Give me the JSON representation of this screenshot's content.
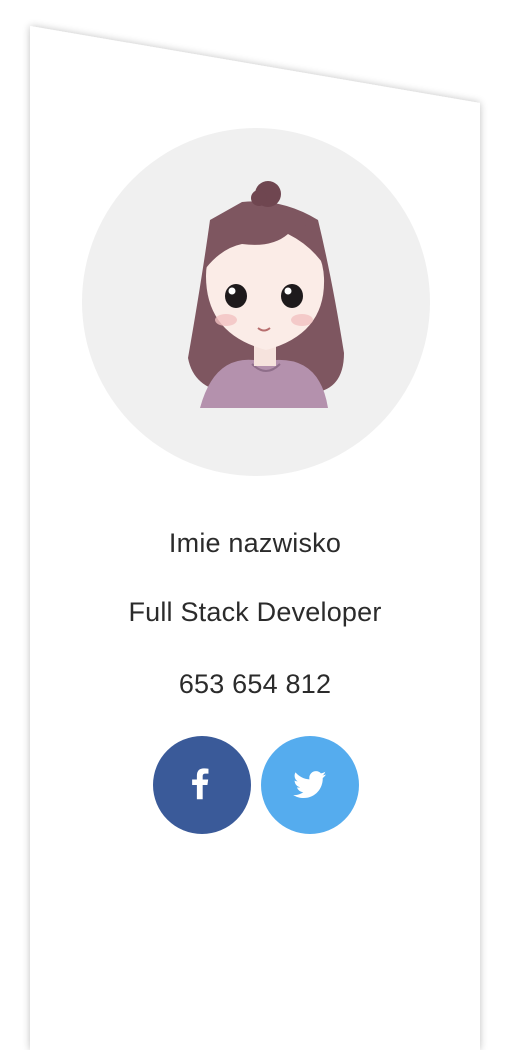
{
  "profile": {
    "name": "Imie nazwisko",
    "title": "Full Stack Developer",
    "phone": "653 654 812",
    "avatar_icon": "cartoon-girl-avatar"
  },
  "social": [
    {
      "network": "facebook",
      "icon": "facebook-icon",
      "color": "#3a5a99"
    },
    {
      "network": "twitter",
      "icon": "twitter-icon",
      "color": "#55acee"
    }
  ],
  "colors": {
    "card_background": "#ffffff",
    "avatar_background": "#f0f0f0",
    "text": "#2b2b2b"
  }
}
